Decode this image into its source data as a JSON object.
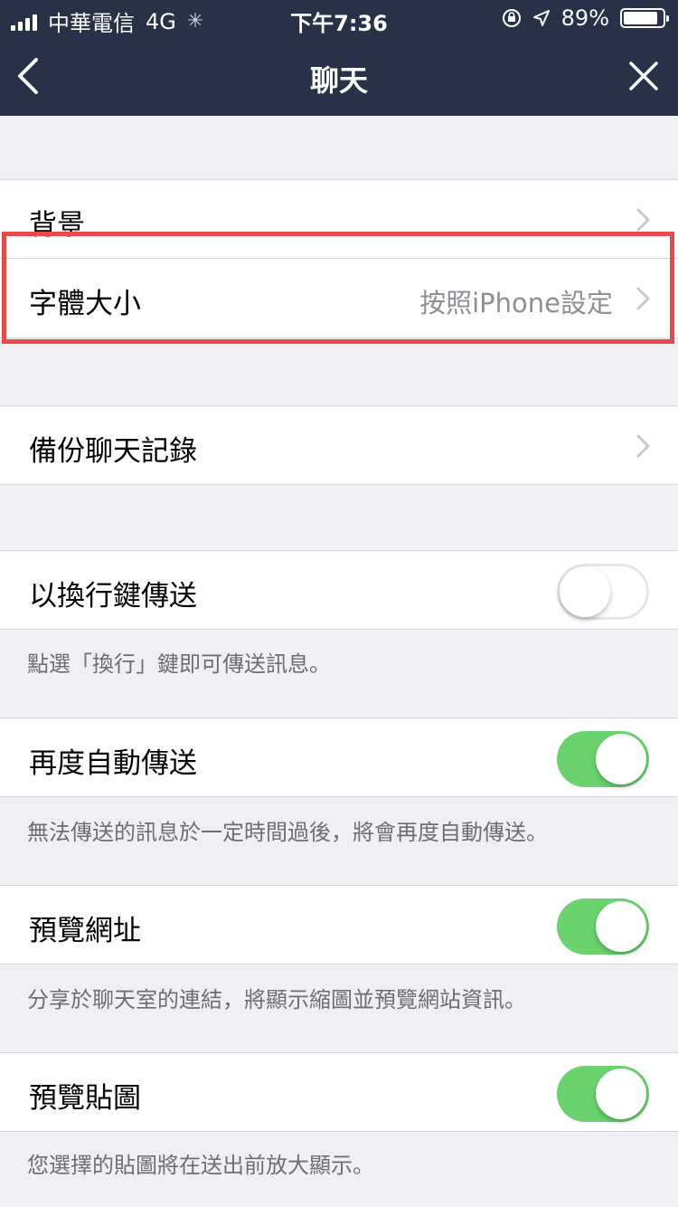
{
  "status_bar": {
    "carrier": "中華電信",
    "network": "4G",
    "time": "下午7:36",
    "battery_percent": "89%",
    "battery_level": 0.89
  },
  "nav": {
    "title": "聊天",
    "back_icon": "chevron-left-icon",
    "close_icon": "close-icon"
  },
  "rows": {
    "background": {
      "label": "背景"
    },
    "font_size": {
      "label": "字體大小",
      "value": "按照iPhone設定"
    },
    "backup": {
      "label": "備份聊天記錄"
    },
    "enter_to_send": {
      "label": "以換行鍵傳送",
      "on": false,
      "note": "點選「換行」鍵即可傳送訊息。"
    },
    "auto_resend": {
      "label": "再度自動傳送",
      "on": true,
      "note": "無法傳送的訊息於一定時間過後，將會再度自動傳送。"
    },
    "url_preview": {
      "label": "預覽網址",
      "on": true,
      "note": "分享於聊天室的連結，將顯示縮圖並預覽網站資訊。"
    },
    "sticker_preview": {
      "label": "預覽貼圖",
      "on": true,
      "note": "您選擇的貼圖將在送出前放大顯示。"
    }
  },
  "colors": {
    "nav_bg": "#283147",
    "toggle_on": "#6ad36e",
    "highlight": "#e84a4a"
  }
}
